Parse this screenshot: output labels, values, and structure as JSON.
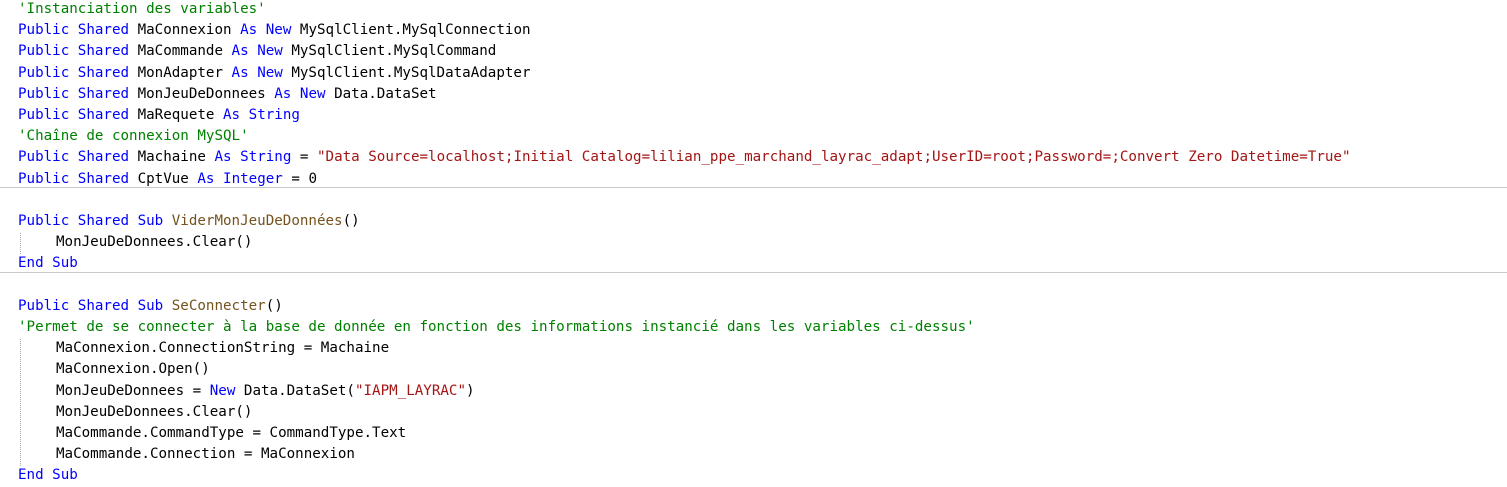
{
  "editor": {
    "colors": {
      "keyword": "#0000ff",
      "type": "#2b91af",
      "comment": "#008000",
      "string": "#a31515",
      "method": "#74531f",
      "plain": "#000000",
      "separator": "#c9c9c9"
    },
    "lines": [
      {
        "indent": 0,
        "tokens": [
          {
            "t": "'Instanciation des variables'",
            "c": "cm"
          }
        ]
      },
      {
        "indent": 0,
        "tokens": [
          {
            "t": "Public",
            "c": "kw"
          },
          {
            "t": " ",
            "c": "pl"
          },
          {
            "t": "Shared",
            "c": "kw"
          },
          {
            "t": " MaConnexion ",
            "c": "pl"
          },
          {
            "t": "As",
            "c": "kw"
          },
          {
            "t": " ",
            "c": "pl"
          },
          {
            "t": "New",
            "c": "kw"
          },
          {
            "t": " MySqlClient.MySqlConnection",
            "c": "pl"
          }
        ]
      },
      {
        "indent": 0,
        "tokens": [
          {
            "t": "Public",
            "c": "kw"
          },
          {
            "t": " ",
            "c": "pl"
          },
          {
            "t": "Shared",
            "c": "kw"
          },
          {
            "t": " MaCommande ",
            "c": "pl"
          },
          {
            "t": "As",
            "c": "kw"
          },
          {
            "t": " ",
            "c": "pl"
          },
          {
            "t": "New",
            "c": "kw"
          },
          {
            "t": " MySqlClient.MySqlCommand",
            "c": "pl"
          }
        ]
      },
      {
        "indent": 0,
        "tokens": [
          {
            "t": "Public",
            "c": "kw"
          },
          {
            "t": " ",
            "c": "pl"
          },
          {
            "t": "Shared",
            "c": "kw"
          },
          {
            "t": " MonAdapter ",
            "c": "pl"
          },
          {
            "t": "As",
            "c": "kw"
          },
          {
            "t": " ",
            "c": "pl"
          },
          {
            "t": "New",
            "c": "kw"
          },
          {
            "t": " MySqlClient.MySqlDataAdapter",
            "c": "pl"
          }
        ]
      },
      {
        "indent": 0,
        "tokens": [
          {
            "t": "Public",
            "c": "kw"
          },
          {
            "t": " ",
            "c": "pl"
          },
          {
            "t": "Shared",
            "c": "kw"
          },
          {
            "t": " MonJeuDeDonnees ",
            "c": "pl"
          },
          {
            "t": "As",
            "c": "kw"
          },
          {
            "t": " ",
            "c": "pl"
          },
          {
            "t": "New",
            "c": "kw"
          },
          {
            "t": " Data.DataSet",
            "c": "pl"
          }
        ]
      },
      {
        "indent": 0,
        "tokens": [
          {
            "t": "Public",
            "c": "kw"
          },
          {
            "t": " ",
            "c": "pl"
          },
          {
            "t": "Shared",
            "c": "kw"
          },
          {
            "t": " MaRequete ",
            "c": "pl"
          },
          {
            "t": "As",
            "c": "kw"
          },
          {
            "t": " ",
            "c": "pl"
          },
          {
            "t": "String",
            "c": "kw"
          }
        ]
      },
      {
        "indent": 0,
        "tokens": [
          {
            "t": "'Chaîne de connexion MySQL'",
            "c": "cm"
          }
        ]
      },
      {
        "indent": 0,
        "tokens": [
          {
            "t": "Public",
            "c": "kw"
          },
          {
            "t": " ",
            "c": "pl"
          },
          {
            "t": "Shared",
            "c": "kw"
          },
          {
            "t": " Machaine ",
            "c": "pl"
          },
          {
            "t": "As",
            "c": "kw"
          },
          {
            "t": " ",
            "c": "pl"
          },
          {
            "t": "String",
            "c": "kw"
          },
          {
            "t": " = ",
            "c": "pl"
          },
          {
            "t": "\"Data Source=localhost;Initial Catalog=lilian_ppe_marchand_layrac_adapt;UserID=root;Password=;Convert Zero Datetime=True\"",
            "c": "st"
          }
        ]
      },
      {
        "indent": 0,
        "tokens": [
          {
            "t": "Public",
            "c": "kw"
          },
          {
            "t": " ",
            "c": "pl"
          },
          {
            "t": "Shared",
            "c": "kw"
          },
          {
            "t": " CptVue ",
            "c": "pl"
          },
          {
            "t": "As",
            "c": "kw"
          },
          {
            "t": " ",
            "c": "pl"
          },
          {
            "t": "Integer",
            "c": "kw"
          },
          {
            "t": " = 0",
            "c": "pl"
          }
        ]
      },
      {
        "indent": 0,
        "tokens": []
      },
      {
        "indent": 0,
        "tokens": [
          {
            "t": "Public",
            "c": "kw"
          },
          {
            "t": " ",
            "c": "pl"
          },
          {
            "t": "Shared",
            "c": "kw"
          },
          {
            "t": " ",
            "c": "pl"
          },
          {
            "t": "Sub",
            "c": "kw"
          },
          {
            "t": " ",
            "c": "pl"
          },
          {
            "t": "ViderMonJeuDeDonnées",
            "c": "mt"
          },
          {
            "t": "()",
            "c": "pl"
          }
        ]
      },
      {
        "indent": 1,
        "tokens": [
          {
            "t": "MonJeuDeDonnees.Clear()",
            "c": "pl"
          }
        ]
      },
      {
        "indent": 0,
        "tokens": [
          {
            "t": "End",
            "c": "kw"
          },
          {
            "t": " ",
            "c": "pl"
          },
          {
            "t": "Sub",
            "c": "kw"
          }
        ]
      },
      {
        "indent": 0,
        "tokens": []
      },
      {
        "indent": 0,
        "tokens": [
          {
            "t": "Public",
            "c": "kw"
          },
          {
            "t": " ",
            "c": "pl"
          },
          {
            "t": "Shared",
            "c": "kw"
          },
          {
            "t": " ",
            "c": "pl"
          },
          {
            "t": "Sub",
            "c": "kw"
          },
          {
            "t": " ",
            "c": "pl"
          },
          {
            "t": "SeConnecter",
            "c": "mt"
          },
          {
            "t": "()",
            "c": "pl"
          }
        ]
      },
      {
        "indent": 0,
        "tokens": [
          {
            "t": "'Permet de se connecter à la base de donnée en fonction des informations instancié dans les variables ci-dessus'",
            "c": "cm"
          }
        ]
      },
      {
        "indent": 1,
        "tokens": [
          {
            "t": "MaConnexion.ConnectionString = Machaine",
            "c": "pl"
          }
        ]
      },
      {
        "indent": 1,
        "tokens": [
          {
            "t": "MaConnexion.Open()",
            "c": "pl"
          }
        ]
      },
      {
        "indent": 1,
        "tokens": [
          {
            "t": "MonJeuDeDonnees = ",
            "c": "pl"
          },
          {
            "t": "New",
            "c": "kw"
          },
          {
            "t": " Data.DataSet(",
            "c": "pl"
          },
          {
            "t": "\"IAPM_LAYRAC\"",
            "c": "st"
          },
          {
            "t": ")",
            "c": "pl"
          }
        ]
      },
      {
        "indent": 1,
        "tokens": [
          {
            "t": "MonJeuDeDonnees.Clear()",
            "c": "pl"
          }
        ]
      },
      {
        "indent": 1,
        "tokens": [
          {
            "t": "MaCommande.CommandType = CommandType.Text",
            "c": "pl"
          }
        ]
      },
      {
        "indent": 1,
        "tokens": [
          {
            "t": "MaCommande.Connection = MaConnexion",
            "c": "pl"
          }
        ]
      },
      {
        "indent": 0,
        "tokens": [
          {
            "t": "End",
            "c": "kw"
          },
          {
            "t": " ",
            "c": "pl"
          },
          {
            "t": "Sub",
            "c": "kw"
          }
        ]
      }
    ]
  }
}
